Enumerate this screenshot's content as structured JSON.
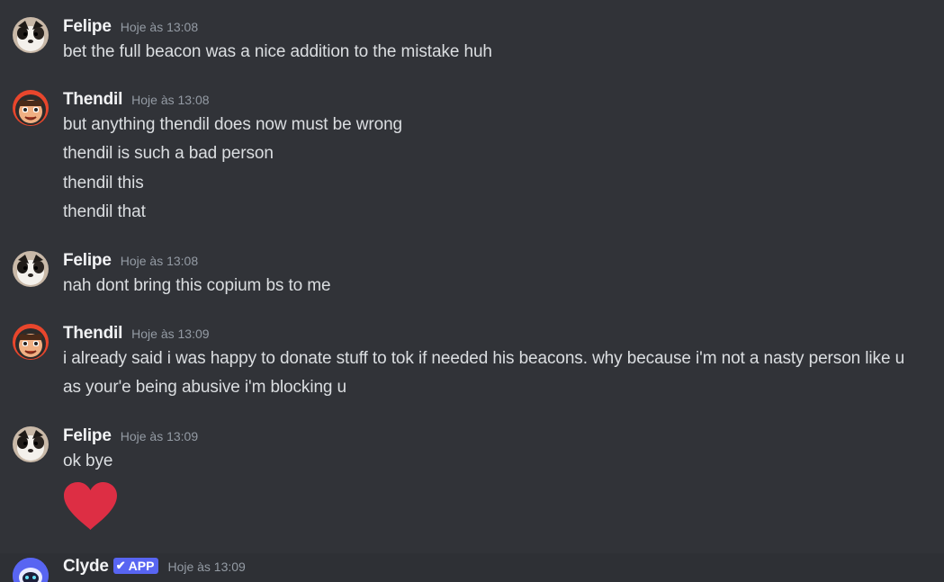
{
  "messages": [
    {
      "author": "Felipe",
      "timestamp": "Hoje às 13:08",
      "lines": [
        "bet the full beacon was a nice addition to the mistake huh"
      ]
    },
    {
      "author": "Thendil",
      "timestamp": "Hoje às 13:08",
      "lines": [
        "but anything thendil does now must be wrong",
        "thendil is such a bad person",
        "thendil this",
        "thendil that"
      ]
    },
    {
      "author": "Felipe",
      "timestamp": "Hoje às 13:08",
      "lines": [
        "nah dont bring this copium bs to me"
      ]
    },
    {
      "author": "Thendil",
      "timestamp": "Hoje às 13:09",
      "lines": [
        "i already said i was happy to donate stuff to tok if needed his beacons. why because i'm not a nasty person like u",
        "as your'e being abusive i'm blocking u"
      ]
    },
    {
      "author": "Felipe",
      "timestamp": "Hoje às 13:09",
      "lines": [
        "ok bye"
      ],
      "emoji": "red-heart"
    },
    {
      "author": "Clyde",
      "badge": "APP",
      "badge_icon": "check-icon",
      "timestamp": "Hoje às 13:09"
    }
  ],
  "colors": {
    "background": "#313338",
    "username": "#f2f3f5",
    "message_text": "#dbdee1",
    "timestamp": "#949ba4",
    "app_badge": "#5865f2",
    "heart": "#dd2e44"
  }
}
